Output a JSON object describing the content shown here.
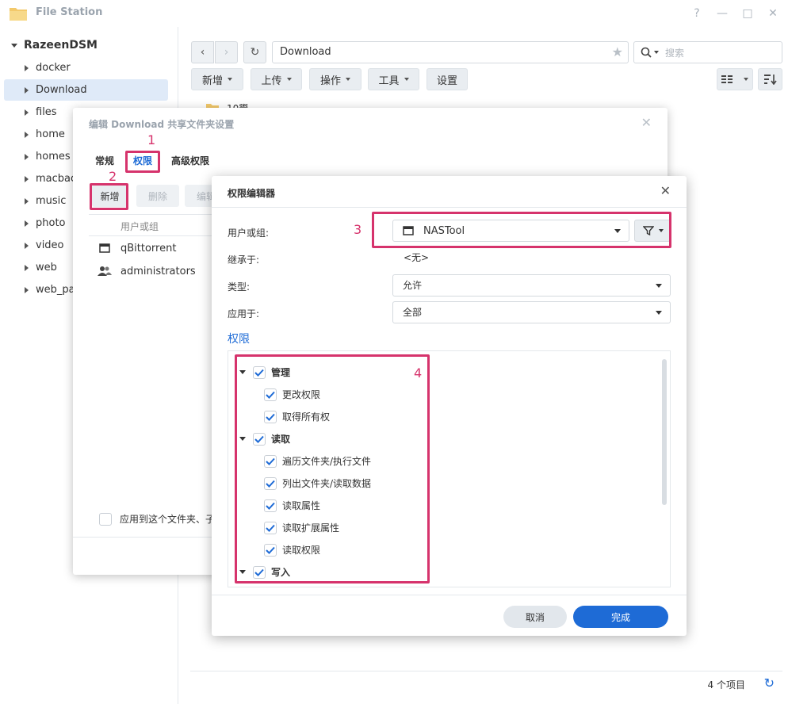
{
  "window": {
    "title": "File Station",
    "controls": {
      "help": "?",
      "minimize": "—",
      "maximize": "□",
      "close": "✕"
    }
  },
  "sidebar": {
    "root": "RazeenDSM",
    "items": [
      {
        "label": "docker"
      },
      {
        "label": "Download"
      },
      {
        "label": "files"
      },
      {
        "label": "home"
      },
      {
        "label": "homes"
      },
      {
        "label": "macbac"
      },
      {
        "label": "music"
      },
      {
        "label": "photo"
      },
      {
        "label": "video"
      },
      {
        "label": "web"
      },
      {
        "label": "web_pa"
      }
    ]
  },
  "toolbar": {
    "path": "Download",
    "search_placeholder": "搜索",
    "buttons": {
      "create": "新增",
      "upload": "上传",
      "action": "操作",
      "tools": "工具",
      "settings": "设置"
    }
  },
  "file_list": {
    "first_row_label": "10鬻"
  },
  "statusbar": {
    "count": "4 个项目"
  },
  "share_dialog": {
    "title": "编辑 Download 共享文件夹设置",
    "tabs": {
      "general": "常规",
      "permissions": "权限",
      "advanced": "高级权限"
    },
    "buttons": {
      "create": "新增",
      "delete": "删除",
      "edit": "编辑"
    },
    "column_header": "用户或组",
    "rows": [
      {
        "name": "qBittorrent"
      },
      {
        "name": "administrators"
      }
    ],
    "apply_label": "应用到这个文件夹、子"
  },
  "annotations": {
    "n1": "1",
    "n2": "2",
    "n3": "3",
    "n4": "4",
    "color": "#d6336c"
  },
  "perm_editor": {
    "title": "权限编辑器",
    "labels": {
      "user_or_group": "用户或组:",
      "inherit": "继承于:",
      "type": "类型:",
      "apply_to": "应用于:"
    },
    "values": {
      "user_or_group": "NASTool",
      "inherit": "<无>",
      "type": "允许",
      "apply_to": "全部"
    },
    "section_title": "权限",
    "permissions": {
      "manage": {
        "label": "管理",
        "items": [
          "更改权限",
          "取得所有权"
        ]
      },
      "read": {
        "label": "读取",
        "items": [
          "遍历文件夹/执行文件",
          "列出文件夹/读取数据",
          "读取属性",
          "读取扩展属性",
          "读取权限"
        ]
      },
      "write": {
        "label": "写入"
      }
    },
    "buttons": {
      "cancel": "取消",
      "done": "完成"
    }
  },
  "colors": {
    "accent": "#1e6bd6",
    "selected_bg": "#dfeaf8"
  }
}
